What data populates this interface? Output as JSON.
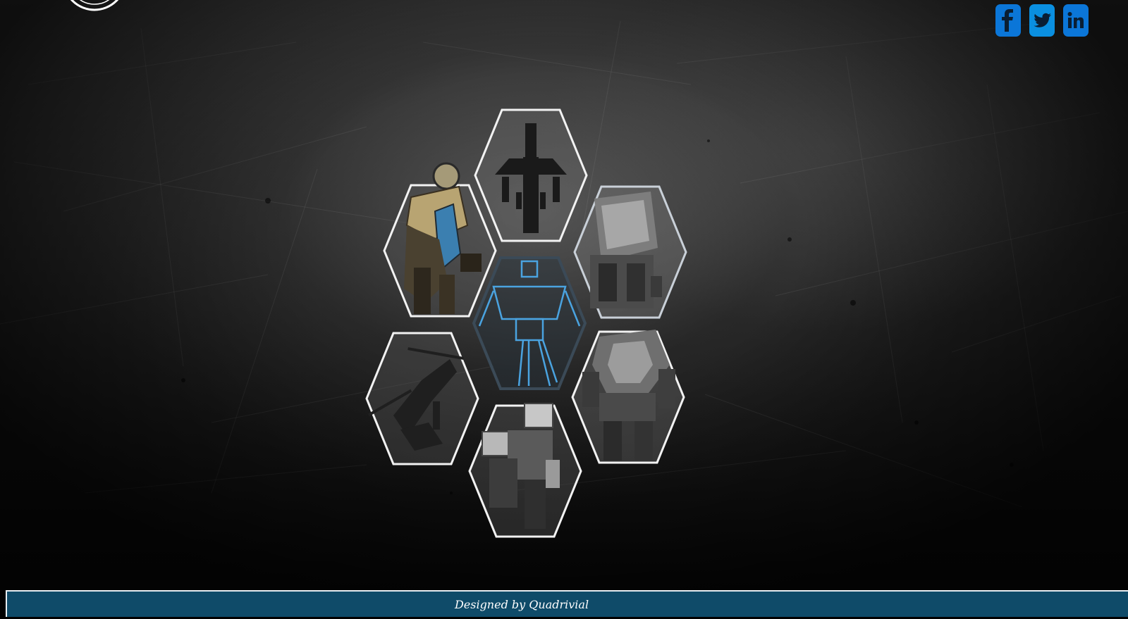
{
  "header": {
    "social": [
      {
        "name": "facebook",
        "icon": "facebook-icon",
        "glyph": "f"
      },
      {
        "name": "twitter",
        "icon": "twitter-icon",
        "glyph": "t"
      },
      {
        "name": "linkedin",
        "icon": "linkedin-icon",
        "glyph": "in"
      }
    ]
  },
  "gallery": {
    "tiles": [
      {
        "id": "gunship",
        "icon": "aircraft-silhouette-icon"
      },
      {
        "id": "gold-mech",
        "icon": "gold-mech-icon"
      },
      {
        "id": "tank",
        "icon": "tank-icon"
      },
      {
        "id": "blue-mech",
        "icon": "blueprint-mech-icon"
      },
      {
        "id": "helicopter",
        "icon": "helicopter-icon"
      },
      {
        "id": "heavy-mech",
        "icon": "heavy-mech-icon"
      },
      {
        "id": "walker-mech",
        "icon": "walker-mech-icon"
      }
    ]
  },
  "footer": {
    "credit": "Designed by Quadrivial"
  },
  "colors": {
    "footer_bg": "#0f4b69",
    "social_blue": "#0b76d8",
    "hex_border": "#f2f2f2"
  }
}
